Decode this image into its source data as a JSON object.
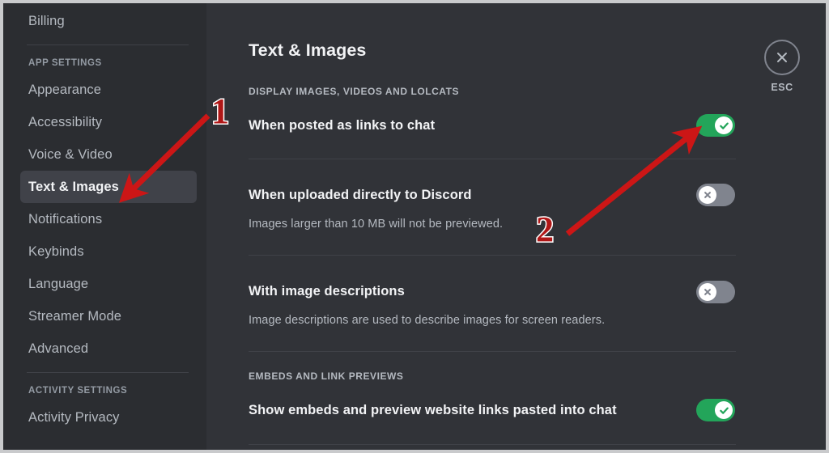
{
  "app": {
    "accent_green": "#23a55a",
    "toggle_off_gray": "#80848e",
    "sidebar_bg": "#2b2d31",
    "content_bg": "#313338",
    "selected_bg": "#404249",
    "annotation_red": "#b01717"
  },
  "sidebar": {
    "top_item": {
      "label": "Billing"
    },
    "app_settings_header": "APP SETTINGS",
    "app_settings_items": [
      {
        "label": "Appearance",
        "selected": false
      },
      {
        "label": "Accessibility",
        "selected": false
      },
      {
        "label": "Voice & Video",
        "selected": false
      },
      {
        "label": "Text & Images",
        "selected": true
      },
      {
        "label": "Notifications",
        "selected": false
      },
      {
        "label": "Keybinds",
        "selected": false
      },
      {
        "label": "Language",
        "selected": false
      },
      {
        "label": "Streamer Mode",
        "selected": false
      },
      {
        "label": "Advanced",
        "selected": false
      }
    ],
    "activity_settings_header": "ACTIVITY SETTINGS",
    "activity_settings_items": [
      {
        "label": "Activity Privacy",
        "selected": false
      }
    ]
  },
  "header": {
    "title": "Text & Images",
    "close": {
      "icon": "close-x-icon",
      "label": "ESC"
    }
  },
  "main": {
    "sections": [
      {
        "heading": "DISPLAY IMAGES, VIDEOS AND LOLCATS",
        "rows": [
          {
            "title": "When posted as links to chat",
            "note": "",
            "toggle_state": "on",
            "toggle_icon": "check-icon"
          },
          {
            "title": "When uploaded directly to Discord",
            "note": "Images larger than 10 MB will not be previewed.",
            "toggle_state": "off",
            "toggle_icon": "x-icon"
          },
          {
            "title": "With image descriptions",
            "note": "Image descriptions are used to describe images for screen readers.",
            "toggle_state": "off",
            "toggle_icon": "x-icon"
          }
        ]
      },
      {
        "heading": "EMBEDS AND LINK PREVIEWS",
        "rows": [
          {
            "title": "Show embeds and preview website links pasted into chat",
            "note": "",
            "toggle_state": "on",
            "toggle_icon": "check-icon"
          }
        ]
      }
    ]
  },
  "annotations": [
    {
      "label": "1",
      "target": "sidebar-item-text-and-images"
    },
    {
      "label": "2",
      "target": "toggle-when-posted-as-links-to-chat"
    }
  ]
}
